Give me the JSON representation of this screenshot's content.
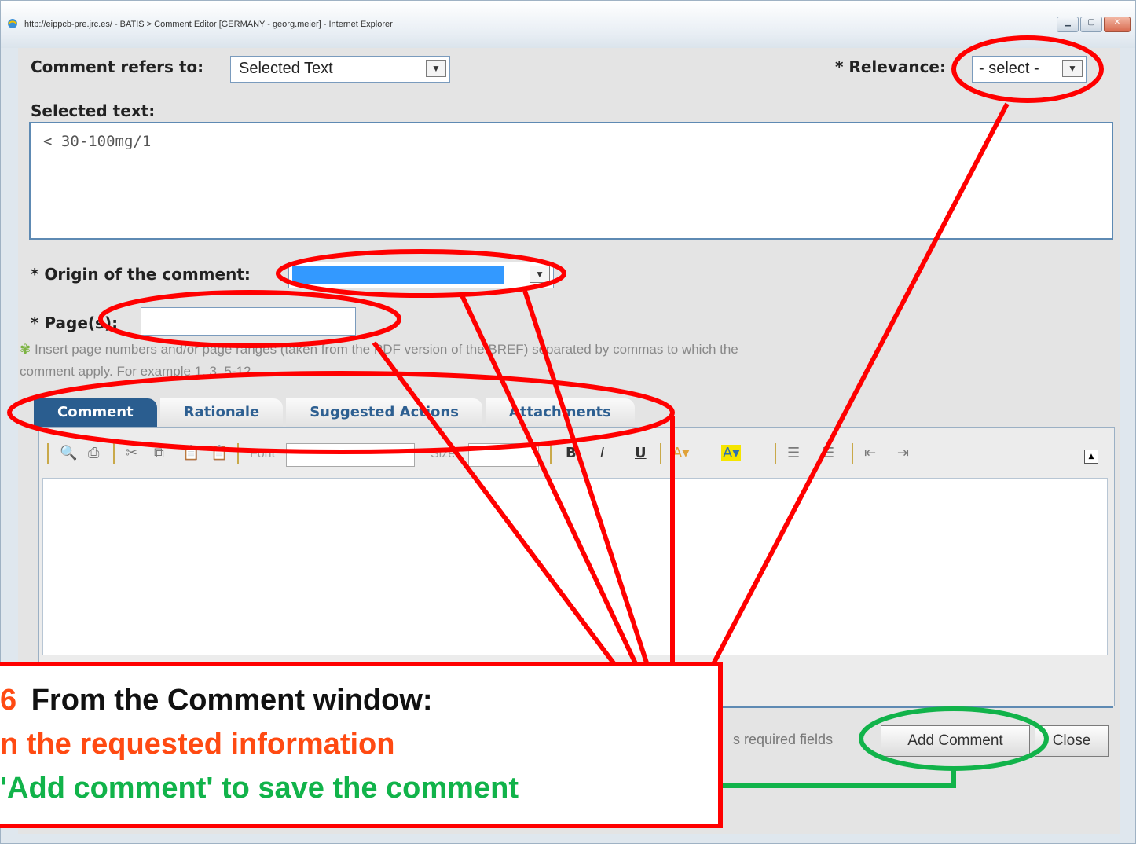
{
  "window": {
    "title": "http://eippcb-pre.jrc.es/ - BATIS > Comment Editor [GERMANY - georg.meier] - Internet Explorer"
  },
  "form": {
    "refers_label": "Comment refers to:",
    "refers_value": "Selected Text",
    "relevance_label": "* Relevance:",
    "relevance_value": "- select -",
    "selected_text_label": "Selected text:",
    "selected_text_value": "< 30-100mg/1",
    "origin_label": "* Origin of the comment:",
    "pages_label": "* Page(s):",
    "hint_line1": "Insert page numbers and/or page ranges (taken from the PDF version of the BREF) separated by commas to which the",
    "hint_line2": "comment apply. For example 1, 3, 5-12."
  },
  "tabs": [
    "Comment",
    "Rationale",
    "Suggested Actions",
    "Attachments"
  ],
  "toolbar": {
    "font_label": "Font",
    "size_label": "Size",
    "bold": "B",
    "italic": "I",
    "underline": "U"
  },
  "footer": {
    "required_text": "s required fields",
    "add_button": "Add Comment",
    "close_button": "Close"
  },
  "callout": {
    "line1_num": "6",
    "line1_text": "From the Comment window:",
    "line2": "n the requested information",
    "line3": "'Add comment' to save the comment"
  },
  "colors": {
    "annotation_red": "#ff0000",
    "annotation_green": "#11b34a",
    "orange": "#ff4a12"
  }
}
